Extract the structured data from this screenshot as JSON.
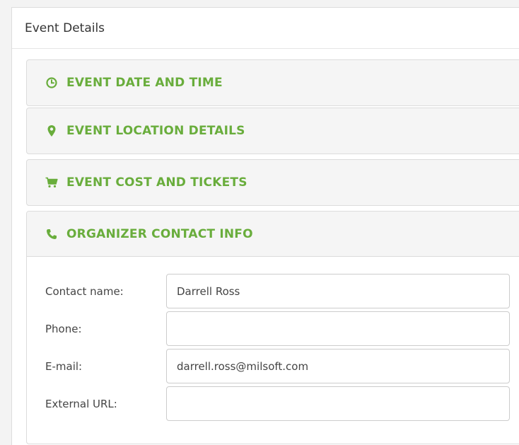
{
  "panel": {
    "title": "Event Details"
  },
  "sections": [
    {
      "icon": "clock-icon",
      "label": "EVENT DATE AND TIME",
      "expanded": false
    },
    {
      "icon": "map-marker-icon",
      "label": "EVENT LOCATION DETAILS",
      "expanded": false
    },
    {
      "icon": "shopping-cart-icon",
      "label": "EVENT COST AND TICKETS",
      "expanded": false
    },
    {
      "icon": "phone-icon",
      "label": "ORGANIZER CONTACT INFO",
      "expanded": true
    }
  ],
  "contact_form": {
    "contact_name": {
      "label": "Contact name:",
      "value": "Darrell Ross"
    },
    "phone": {
      "label": "Phone:",
      "value": ""
    },
    "email": {
      "label": "E-mail:",
      "value": "darrell.ross@milsoft.com"
    },
    "external_url": {
      "label": "External URL:",
      "value": ""
    }
  },
  "colors": {
    "accent": "#69ad3c",
    "section_bg": "#f5f5f5",
    "border": "#dcdcdc"
  }
}
